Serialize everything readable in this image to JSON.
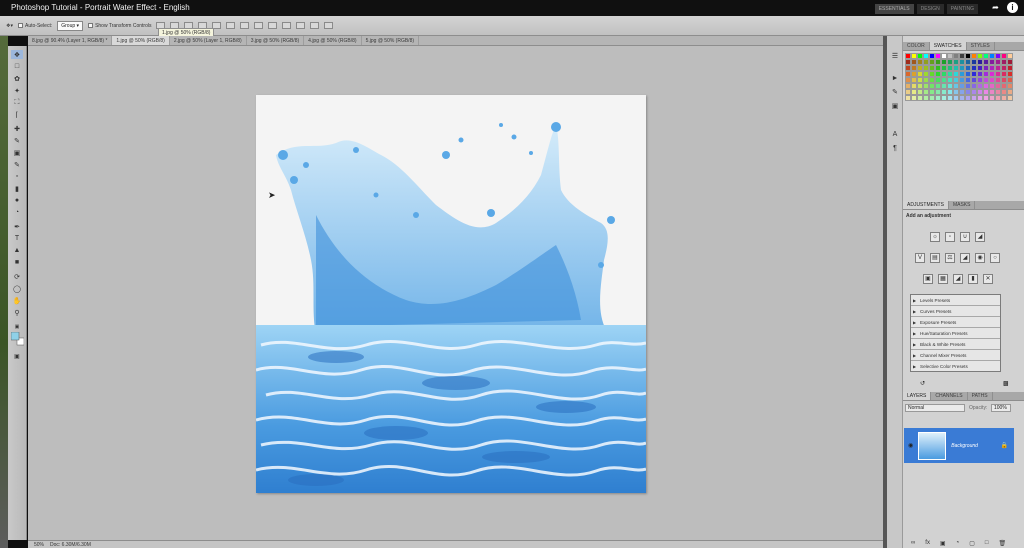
{
  "video_title": "Photoshop Tutorial - Portrait Water Effect - English",
  "workspace_buttons": [
    "ESSENTIALS",
    "DESIGN",
    "PAINTING"
  ],
  "options_bar": {
    "auto_select_label": "Auto-Select:",
    "auto_select_value": "Group",
    "show_transform_label": "Show Transform Controls"
  },
  "tooltip": "1.jpg @ 50% (RGB/8)",
  "doc_tabs": [
    "8.jpg @ 90.4% (Layer 1, RGB/8) *",
    "1.jpg @ 50% (RGB/8)",
    "2.jpg @ 50% (Layer 1, RGB/8)",
    "3.jpg @ 50% (RGB/8)",
    "4.jpg @ 50% (RGB/8)",
    "5.jpg @ 50% (RGB/8)"
  ],
  "status": {
    "zoom": "50%",
    "doc": "Doc: 6.30M/6.30M"
  },
  "panels": {
    "color_tabs": [
      "COLOR",
      "SWATCHES",
      "STYLES"
    ],
    "adjust_tabs": [
      "ADJUSTMENTS",
      "MASKS"
    ],
    "adjust_title": "Add an adjustment",
    "presets": [
      "Levels Presets",
      "Curves Presets",
      "Exposure Presets",
      "Hue/Saturation Presets",
      "Black & White Presets",
      "Channel Mixer Presets",
      "Selective Color Presets"
    ],
    "layer_tabs": [
      "LAYERS",
      "CHANNELS",
      "PATHS"
    ],
    "blend_mode": "Normal",
    "opacity_label": "Opacity:",
    "opacity_value": "100%",
    "layer_name": "Background"
  },
  "colors": {
    "layer_highlight": "#3a7bd5",
    "water": "#4a9be0"
  }
}
